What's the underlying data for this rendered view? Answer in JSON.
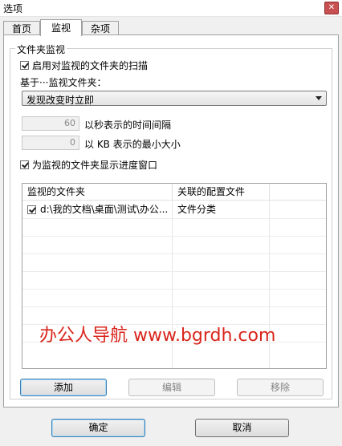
{
  "window": {
    "title": "选项",
    "close_glyph": "✕"
  },
  "tabs": [
    {
      "label": "首页",
      "active": false
    },
    {
      "label": "监视",
      "active": true
    },
    {
      "label": "杂项",
      "active": false
    }
  ],
  "group": {
    "title": "文件夹监视",
    "enable_scan": {
      "label": "启用对监视的文件夹的扫描",
      "checked": true
    },
    "based_on_label": "基于···监视文件夹：",
    "mode_select": {
      "value": "发现改变时立即"
    },
    "interval": {
      "value": "60",
      "label": "以秒表示的时间间隔"
    },
    "min_size": {
      "value": "0",
      "label": "以 KB 表示的最小大小"
    },
    "show_progress": {
      "label": "为监视的文件夹显示进度窗口",
      "checked": true
    },
    "table": {
      "headers": [
        "监视的文件夹",
        "关联的配置文件"
      ],
      "rows": [
        {
          "checked": true,
          "folder": "d:\\我的文档\\桌面\\测试\\办公...",
          "profile": "文件分类"
        }
      ]
    },
    "buttons": {
      "add": "添加",
      "edit": "编辑",
      "remove": "移除"
    }
  },
  "footer": {
    "ok": "确定",
    "cancel": "取消"
  },
  "watermark": "办公人导航 www.bgrdh.com"
}
